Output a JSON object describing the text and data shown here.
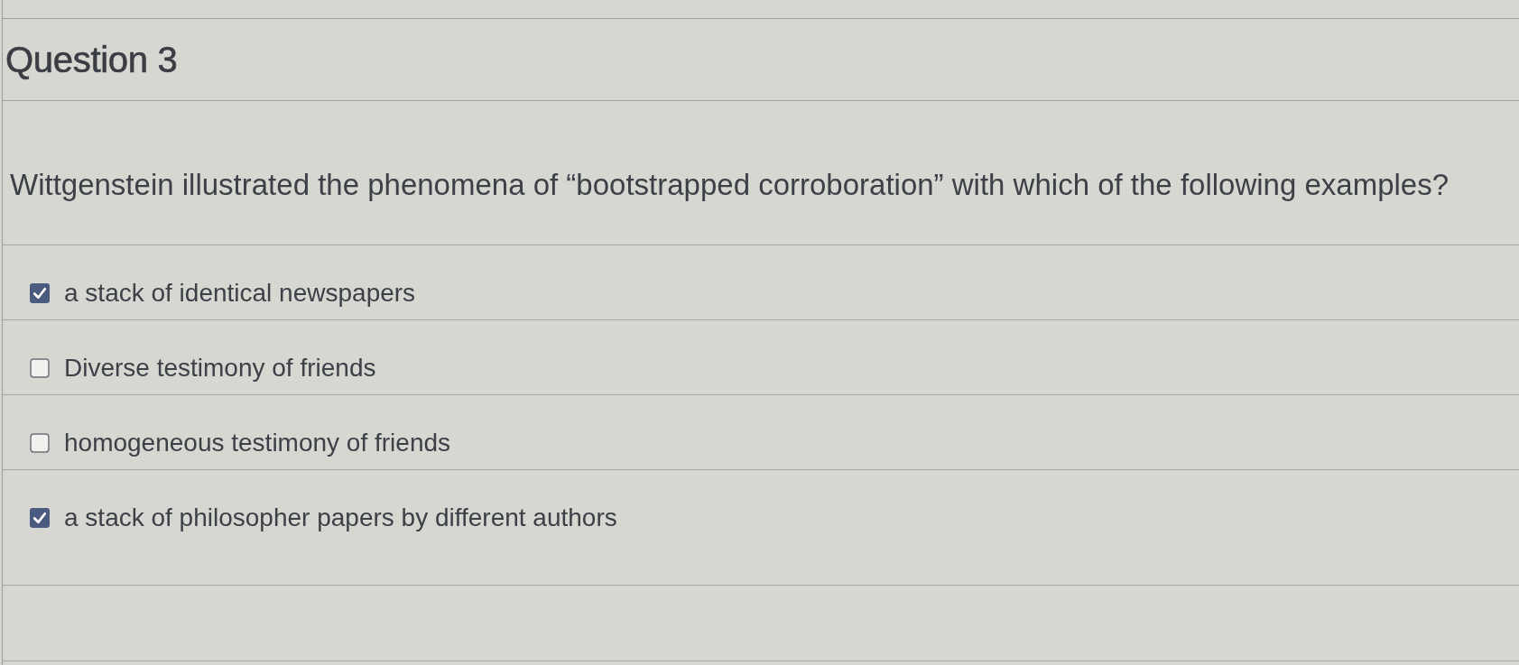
{
  "question": {
    "title": "Question 3",
    "prompt": "Wittgenstein illustrated the phenomena of “bootstrapped corroboration” with which of the following examples?",
    "answers": [
      {
        "label": "a stack of identical newspapers",
        "checked": true
      },
      {
        "label": "Diverse testimony of friends",
        "checked": false
      },
      {
        "label": "homogeneous testimony of friends",
        "checked": false
      },
      {
        "label": "a stack of philosopher papers by different authors",
        "checked": true
      }
    ]
  }
}
